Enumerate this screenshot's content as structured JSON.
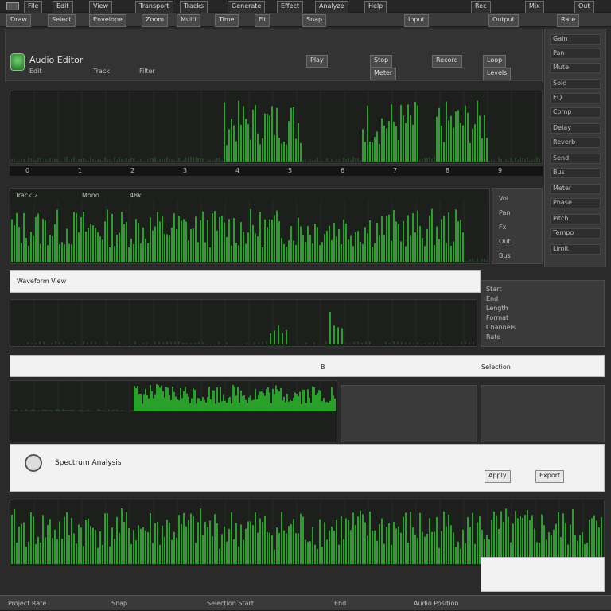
{
  "toolbar": {
    "items": [
      "File",
      "Edit",
      "View",
      "Transport",
      "Tracks",
      "Generate",
      "Effect",
      "Analyze",
      "Help"
    ],
    "right_items": [
      "Rec",
      "Mix",
      "Out"
    ]
  },
  "secondary_bar": {
    "items": [
      "Draw",
      "Select",
      "Envelope",
      "Zoom",
      "Multi",
      "Time",
      "Fit",
      "Snap",
      "Input",
      "Output",
      "Rate"
    ]
  },
  "header": {
    "title": "Audio Editor",
    "subtitle_items": [
      "Edit",
      "Track",
      "Filter"
    ]
  },
  "header_buttons": [
    "Play",
    "Stop",
    "Record",
    "Loop",
    "Meter",
    "Levels"
  ],
  "right_panel": {
    "items": [
      "Gain",
      "Pan",
      "Mute",
      "Solo",
      "EQ",
      "Comp",
      "Delay",
      "Reverb",
      "Send",
      "Bus",
      "Meter",
      "Phase",
      "Pitch",
      "Tempo",
      "Limit"
    ]
  },
  "track1": {
    "scale_labels": [
      "0",
      "1",
      "2",
      "3",
      "4",
      "5",
      "6",
      "7",
      "8",
      "9"
    ]
  },
  "track2": {
    "labels": [
      "Track 2",
      "Mono",
      "48k"
    ],
    "side_items": [
      "Vol",
      "Pan",
      "Fx",
      "Out",
      "Bus"
    ]
  },
  "section3": {
    "title": "Waveform View",
    "side_items": [
      "Start",
      "End",
      "Length",
      "Format",
      "Channels",
      "Rate"
    ]
  },
  "section4": {
    "marker": "B",
    "right_label": "Selection"
  },
  "section5": {
    "title": "Spectrum Analysis",
    "right_buttons": [
      "Apply",
      "Export"
    ]
  },
  "status": {
    "items": [
      "Project Rate",
      "Snap",
      "Selection Start",
      "End",
      "Audio Position"
    ]
  },
  "colors": {
    "accent": "#2fd82f",
    "panel_dark": "#1d1f1d",
    "chrome": "#3a3a3a"
  }
}
